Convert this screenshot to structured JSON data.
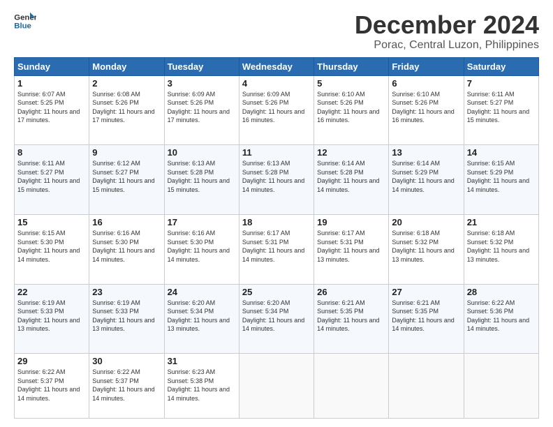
{
  "logo": {
    "line1": "General",
    "line2": "Blue"
  },
  "title": "December 2024",
  "subtitle": "Porac, Central Luzon, Philippines",
  "headers": [
    "Sunday",
    "Monday",
    "Tuesday",
    "Wednesday",
    "Thursday",
    "Friday",
    "Saturday"
  ],
  "weeks": [
    [
      {
        "day": "1",
        "info": "Sunrise: 6:07 AM\nSunset: 5:25 PM\nDaylight: 11 hours and 17 minutes."
      },
      {
        "day": "2",
        "info": "Sunrise: 6:08 AM\nSunset: 5:26 PM\nDaylight: 11 hours and 17 minutes."
      },
      {
        "day": "3",
        "info": "Sunrise: 6:09 AM\nSunset: 5:26 PM\nDaylight: 11 hours and 17 minutes."
      },
      {
        "day": "4",
        "info": "Sunrise: 6:09 AM\nSunset: 5:26 PM\nDaylight: 11 hours and 16 minutes."
      },
      {
        "day": "5",
        "info": "Sunrise: 6:10 AM\nSunset: 5:26 PM\nDaylight: 11 hours and 16 minutes."
      },
      {
        "day": "6",
        "info": "Sunrise: 6:10 AM\nSunset: 5:26 PM\nDaylight: 11 hours and 16 minutes."
      },
      {
        "day": "7",
        "info": "Sunrise: 6:11 AM\nSunset: 5:27 PM\nDaylight: 11 hours and 15 minutes."
      }
    ],
    [
      {
        "day": "8",
        "info": "Sunrise: 6:11 AM\nSunset: 5:27 PM\nDaylight: 11 hours and 15 minutes."
      },
      {
        "day": "9",
        "info": "Sunrise: 6:12 AM\nSunset: 5:27 PM\nDaylight: 11 hours and 15 minutes."
      },
      {
        "day": "10",
        "info": "Sunrise: 6:13 AM\nSunset: 5:28 PM\nDaylight: 11 hours and 15 minutes."
      },
      {
        "day": "11",
        "info": "Sunrise: 6:13 AM\nSunset: 5:28 PM\nDaylight: 11 hours and 14 minutes."
      },
      {
        "day": "12",
        "info": "Sunrise: 6:14 AM\nSunset: 5:28 PM\nDaylight: 11 hours and 14 minutes."
      },
      {
        "day": "13",
        "info": "Sunrise: 6:14 AM\nSunset: 5:29 PM\nDaylight: 11 hours and 14 minutes."
      },
      {
        "day": "14",
        "info": "Sunrise: 6:15 AM\nSunset: 5:29 PM\nDaylight: 11 hours and 14 minutes."
      }
    ],
    [
      {
        "day": "15",
        "info": "Sunrise: 6:15 AM\nSunset: 5:30 PM\nDaylight: 11 hours and 14 minutes."
      },
      {
        "day": "16",
        "info": "Sunrise: 6:16 AM\nSunset: 5:30 PM\nDaylight: 11 hours and 14 minutes."
      },
      {
        "day": "17",
        "info": "Sunrise: 6:16 AM\nSunset: 5:30 PM\nDaylight: 11 hours and 14 minutes."
      },
      {
        "day": "18",
        "info": "Sunrise: 6:17 AM\nSunset: 5:31 PM\nDaylight: 11 hours and 14 minutes."
      },
      {
        "day": "19",
        "info": "Sunrise: 6:17 AM\nSunset: 5:31 PM\nDaylight: 11 hours and 13 minutes."
      },
      {
        "day": "20",
        "info": "Sunrise: 6:18 AM\nSunset: 5:32 PM\nDaylight: 11 hours and 13 minutes."
      },
      {
        "day": "21",
        "info": "Sunrise: 6:18 AM\nSunset: 5:32 PM\nDaylight: 11 hours and 13 minutes."
      }
    ],
    [
      {
        "day": "22",
        "info": "Sunrise: 6:19 AM\nSunset: 5:33 PM\nDaylight: 11 hours and 13 minutes."
      },
      {
        "day": "23",
        "info": "Sunrise: 6:19 AM\nSunset: 5:33 PM\nDaylight: 11 hours and 13 minutes."
      },
      {
        "day": "24",
        "info": "Sunrise: 6:20 AM\nSunset: 5:34 PM\nDaylight: 11 hours and 13 minutes."
      },
      {
        "day": "25",
        "info": "Sunrise: 6:20 AM\nSunset: 5:34 PM\nDaylight: 11 hours and 14 minutes."
      },
      {
        "day": "26",
        "info": "Sunrise: 6:21 AM\nSunset: 5:35 PM\nDaylight: 11 hours and 14 minutes."
      },
      {
        "day": "27",
        "info": "Sunrise: 6:21 AM\nSunset: 5:35 PM\nDaylight: 11 hours and 14 minutes."
      },
      {
        "day": "28",
        "info": "Sunrise: 6:22 AM\nSunset: 5:36 PM\nDaylight: 11 hours and 14 minutes."
      }
    ],
    [
      {
        "day": "29",
        "info": "Sunrise: 6:22 AM\nSunset: 5:37 PM\nDaylight: 11 hours and 14 minutes."
      },
      {
        "day": "30",
        "info": "Sunrise: 6:22 AM\nSunset: 5:37 PM\nDaylight: 11 hours and 14 minutes."
      },
      {
        "day": "31",
        "info": "Sunrise: 6:23 AM\nSunset: 5:38 PM\nDaylight: 11 hours and 14 minutes."
      },
      null,
      null,
      null,
      null
    ]
  ]
}
